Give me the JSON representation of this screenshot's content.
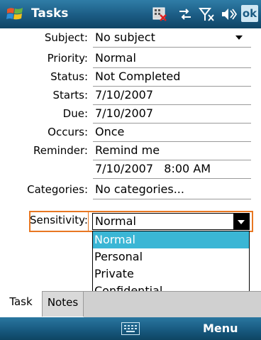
{
  "titlebar": {
    "title": "Tasks",
    "ok_label": "ok"
  },
  "form": {
    "subject": {
      "label": "Subject:",
      "value": "No subject"
    },
    "priority": {
      "label": "Priority:",
      "value": "Normal"
    },
    "status": {
      "label": "Status:",
      "value": "Not Completed"
    },
    "starts": {
      "label": "Starts:",
      "value": "7/10/2007"
    },
    "due": {
      "label": "Due:",
      "value": "7/10/2007"
    },
    "occurs": {
      "label": "Occurs:",
      "value": "Once"
    },
    "reminder": {
      "label": "Reminder:",
      "value": "Remind me",
      "datetime": "7/10/2007   8:00 AM"
    },
    "categories": {
      "label": "Categories:",
      "value": "No categories..."
    },
    "sensitivity": {
      "label": "Sensitivity:",
      "value": "Normal"
    }
  },
  "sensitivity_options": [
    "Normal",
    "Personal",
    "Private",
    "Confidential"
  ],
  "tabs": {
    "task": "Task",
    "notes": "Notes"
  },
  "menubar": {
    "menu_label": "Menu"
  },
  "colors": {
    "focus": "#e87722",
    "selected": "#3ab6d5",
    "titlebar": "#1b5b83"
  }
}
